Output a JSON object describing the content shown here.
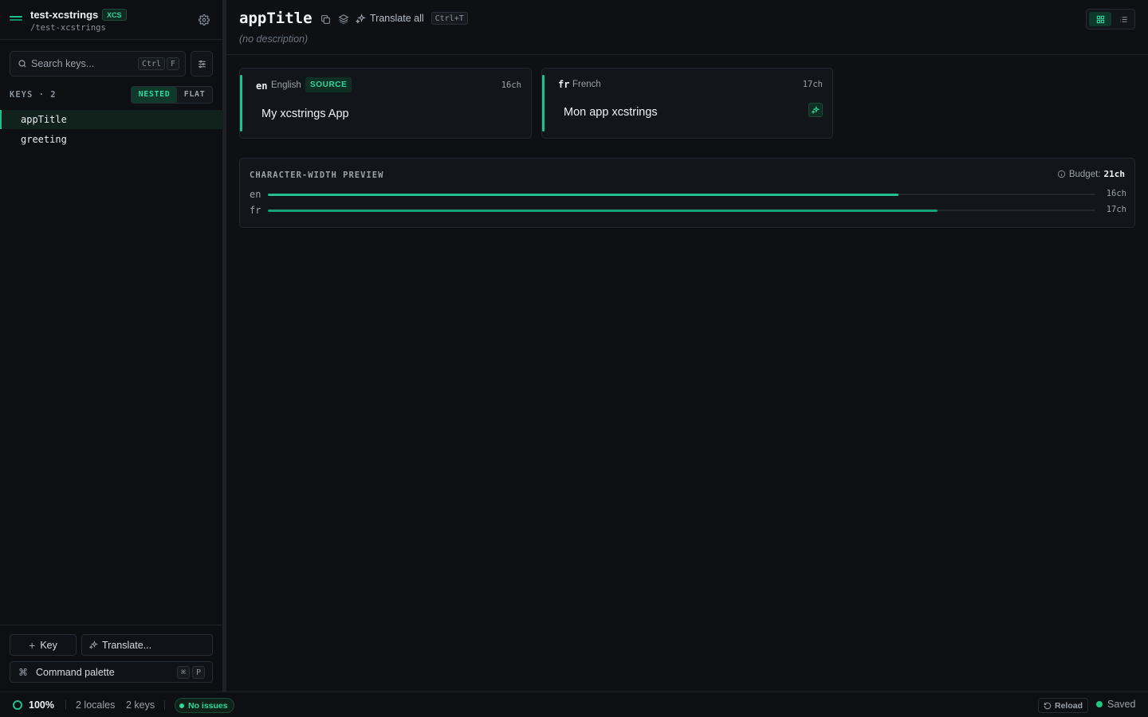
{
  "project": {
    "name": "test-xcstrings",
    "badge": "XCS",
    "path": "/test-xcstrings"
  },
  "search": {
    "placeholder": "Search keys...",
    "shortcut_keys": [
      "Ctrl",
      "F"
    ]
  },
  "keys_panel": {
    "label": "KEYS · 2",
    "modes": [
      "NESTED",
      "FLAT"
    ],
    "active_mode": "NESTED",
    "items": [
      {
        "name": "appTitle",
        "active": true
      },
      {
        "name": "greeting",
        "active": false
      }
    ]
  },
  "sidebar_actions": {
    "add_key_label": "Key",
    "translate_label": "Translate...",
    "command_palette_label": "Command palette",
    "command_palette_keys": [
      "⌘",
      "P"
    ]
  },
  "editor": {
    "key_name": "appTitle",
    "translate_all_label": "Translate all",
    "translate_all_shortcut": "Ctrl+T",
    "description": "(no description)",
    "view_mode": "grid"
  },
  "locales": [
    {
      "code": "en",
      "name": "English",
      "badge": "SOURCE",
      "length": "16ch",
      "value": "My xcstrings App",
      "is_source": true
    },
    {
      "code": "fr",
      "name": "French",
      "badge": "",
      "length": "17ch",
      "value": "Mon app xcstrings",
      "is_source": false
    }
  ],
  "char_width_preview": {
    "title": "CHARACTER-WIDTH PREVIEW",
    "budget_label": "Budget:",
    "budget_value": "21ch",
    "budget": 21,
    "rows": [
      {
        "locale": "en",
        "chars": 16,
        "length": "16ch",
        "color": "#1fbf8f"
      },
      {
        "locale": "fr",
        "chars": 17,
        "length": "17ch",
        "color": "#17a176"
      }
    ]
  },
  "status_bar": {
    "completion": "100%",
    "locales": "2 locales",
    "keys": "2 keys",
    "issues": "No issues",
    "reload_label": "Reload",
    "saved_label": "Saved"
  },
  "colors": {
    "accent": "#1fbf8f",
    "background": "#0e1014",
    "panel": "#12151a"
  }
}
